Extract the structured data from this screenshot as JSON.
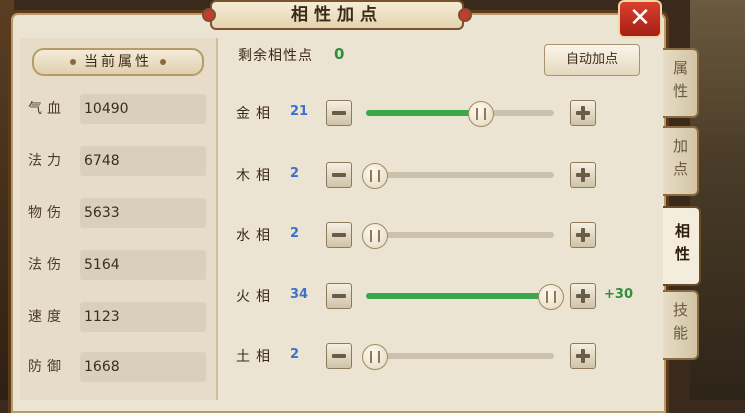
{
  "window": {
    "title": "相性加点",
    "close_label": "✕"
  },
  "left_panel": {
    "header": "当前属性",
    "attributes": [
      {
        "label": "气血",
        "value": "10490"
      },
      {
        "label": "法力",
        "value": "6748"
      },
      {
        "label": "物伤",
        "value": "5633"
      },
      {
        "label": "法伤",
        "value": "5164"
      },
      {
        "label": "速度",
        "value": "1123"
      },
      {
        "label": "防御",
        "value": "1668"
      }
    ]
  },
  "points": {
    "label": "剩余相性点",
    "value": "0"
  },
  "auto_button": "自动加点",
  "stats": [
    {
      "name": "金相",
      "value": "21",
      "level": 0.6,
      "fill": true,
      "bonus": ""
    },
    {
      "name": "木相",
      "value": "2",
      "level": 0.0,
      "fill": false,
      "bonus": ""
    },
    {
      "name": "水相",
      "value": "2",
      "level": 0.0,
      "fill": false,
      "bonus": ""
    },
    {
      "name": "火相",
      "value": "34",
      "level": 1.0,
      "fill": true,
      "bonus": "+30"
    },
    {
      "name": "土相",
      "value": "2",
      "level": 0.0,
      "fill": false,
      "bonus": ""
    }
  ],
  "tabs": [
    {
      "label": "属性",
      "active": false
    },
    {
      "label": "加点",
      "active": false
    },
    {
      "label": "相性",
      "active": true
    },
    {
      "label": "技能",
      "active": false
    }
  ],
  "colors": {
    "accent_green": "#3aa84a",
    "value_blue": "#3d6fcf",
    "close_red": "#c43b2f"
  }
}
